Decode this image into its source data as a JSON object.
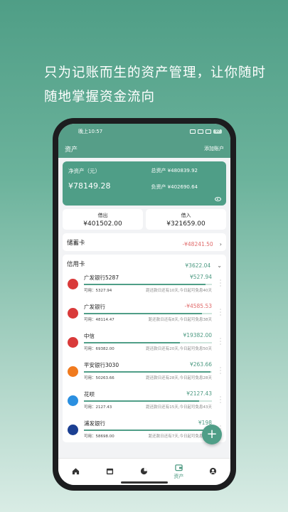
{
  "headline": {
    "line1": "只为记账而生的资产管理，让你随时",
    "line2": "随地掌握资金流向"
  },
  "status": {
    "time": "晚上10:57",
    "battery": "97"
  },
  "header": {
    "title": "资产",
    "add": "添加账户"
  },
  "summary": {
    "net_label": "净资产（元）",
    "net_value": "¥78149.28",
    "total": "总资产 ¥480839.92",
    "debt": "负资产 ¥402690.64"
  },
  "lend": {
    "out_label": "借出",
    "out_value": "¥401502.00",
    "in_label": "借入",
    "in_value": "¥321659.00"
  },
  "debit": {
    "label": "储蓄卡",
    "amount": "-¥48241.50"
  },
  "credit": {
    "label": "信用卡",
    "amount": "¥3622.04",
    "items": [
      {
        "name": "广发银行5287",
        "amount": "¥527.94",
        "avail": "可用：5327.94",
        "note": "距还款日还有10天,今日起可免息40天",
        "color": "#d93a3a",
        "icon": "gf-logo",
        "fill": 0.95
      },
      {
        "name": "广发银行",
        "amount": "-¥4585.53",
        "avail": "可用：48114.47",
        "note": "距还款日还有8天,今日起可免息38天",
        "color": "#d93a3a",
        "icon": "gf-logo",
        "fill": 0.92
      },
      {
        "name": "中信",
        "amount": "¥19382.00",
        "avail": "可用：69382.00",
        "note": "距还款日还有20天,今日起可免息50天",
        "color": "#d93a3a",
        "icon": "citic-logo",
        "fill": 0.75
      },
      {
        "name": "平安银行3030",
        "amount": "¥263.66",
        "avail": "可用：50263.66",
        "note": "距还款日还有28天,今日起可免息28天",
        "color": "#f07a1e",
        "icon": "pingan-logo",
        "fill": 0.99
      },
      {
        "name": "花呗",
        "amount": "¥2127.43",
        "avail": "可用：2127.43",
        "note": "距还款日还有15天,今日起可免息43天",
        "color": "#2a8fe0",
        "icon": "huabei-logo",
        "fill": 0.9
      },
      {
        "name": "浦发银行",
        "amount": "¥198",
        "avail": "可用：58698.00",
        "note": "距还款日还有7天,今日起可免息36天",
        "color": "#1b3f92",
        "icon": "spdb-logo",
        "fill": 0.96
      }
    ]
  },
  "fab": "+",
  "nav": {
    "items": [
      "",
      "",
      "",
      "资产",
      ""
    ],
    "icons": [
      "home-icon",
      "calendar-icon",
      "chart-icon",
      "wallet-icon",
      "profile-icon"
    ]
  }
}
